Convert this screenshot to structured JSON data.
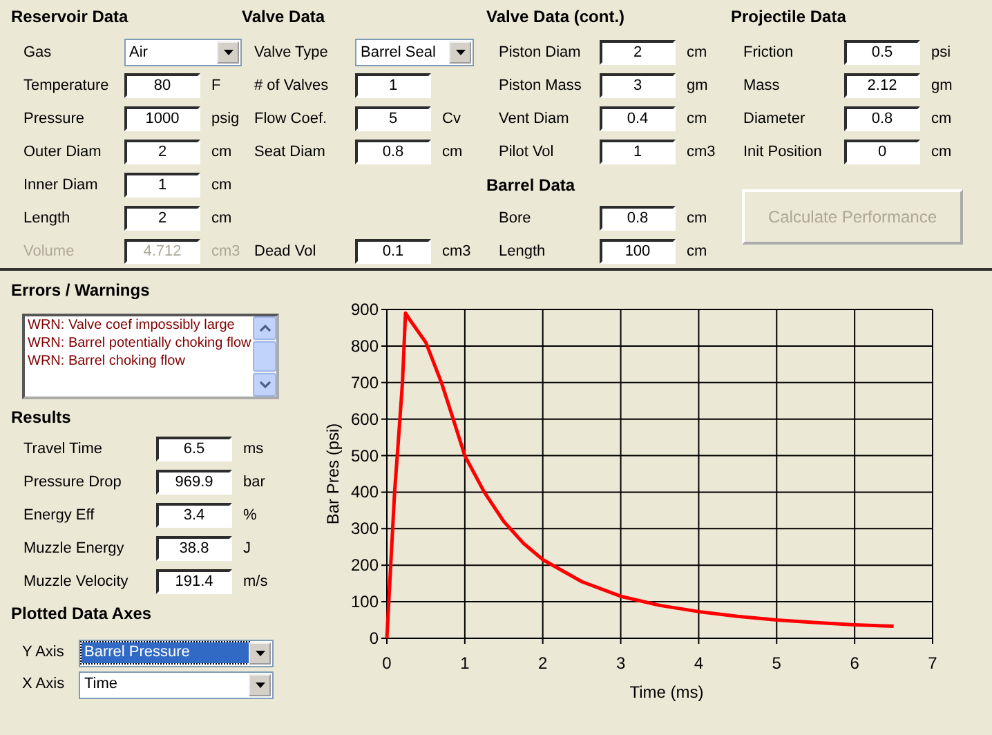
{
  "reservoir_data": {
    "title": "Reservoir Data",
    "fields": [
      {
        "kind": "dropdown",
        "label": "Gas",
        "value": "Air",
        "disabled": false
      },
      {
        "kind": "input",
        "label": "Temperature",
        "value": "80",
        "unit": "F",
        "disabled": false
      },
      {
        "kind": "input",
        "label": "Pressure",
        "value": "1000",
        "unit": "psig",
        "disabled": false
      },
      {
        "kind": "input",
        "label": "Outer Diam",
        "value": "2",
        "unit": "cm",
        "disabled": false
      },
      {
        "kind": "input",
        "label": "Inner Diam",
        "value": "1",
        "unit": "cm",
        "disabled": false
      },
      {
        "kind": "input",
        "label": "Length",
        "value": "2",
        "unit": "cm",
        "disabled": false
      },
      {
        "kind": "input",
        "label": "Volume",
        "value": "4.712",
        "unit": "cm3",
        "disabled": true
      }
    ]
  },
  "valve_data": {
    "title": "Valve Data",
    "fields": [
      {
        "kind": "dropdown",
        "label": "Valve Type",
        "value": "Barrel Seal"
      },
      {
        "kind": "input",
        "label": "# of Valves",
        "value": "1"
      },
      {
        "kind": "input",
        "label": "Flow Coef.",
        "value": "5",
        "unit": "Cv"
      },
      {
        "kind": "input",
        "label": "Seat Diam",
        "value": "0.8",
        "unit": "cm"
      },
      {
        "kind": "input",
        "label": "Dead Vol",
        "value": "0.1",
        "unit": "cm3"
      }
    ]
  },
  "valve_data_cont": {
    "title": "Valve Data (cont.)",
    "fields": [
      {
        "kind": "input",
        "label": "Piston Diam",
        "value": "2",
        "unit": "cm"
      },
      {
        "kind": "input",
        "label": "Piston Mass",
        "value": "3",
        "unit": "gm"
      },
      {
        "kind": "input",
        "label": "Vent Diam",
        "value": "0.4",
        "unit": "cm"
      },
      {
        "kind": "input",
        "label": "Pilot Vol",
        "value": "1",
        "unit": "cm3"
      }
    ]
  },
  "barrel_data": {
    "title": "Barrel Data",
    "fields": [
      {
        "kind": "input",
        "label": "Bore",
        "value": "0.8",
        "unit": "cm"
      },
      {
        "kind": "input",
        "label": "Length",
        "value": "100",
        "unit": "cm"
      }
    ]
  },
  "projectile_data": {
    "title": "Projectile Data",
    "fields": [
      {
        "kind": "input",
        "label": "Friction",
        "value": "0.5",
        "unit": "psi"
      },
      {
        "kind": "input",
        "label": "Mass",
        "value": "2.12",
        "unit": "gm"
      },
      {
        "kind": "input",
        "label": "Diameter",
        "value": "0.8",
        "unit": "cm"
      },
      {
        "kind": "input",
        "label": "Init Position",
        "value": "0",
        "unit": "cm"
      }
    ]
  },
  "calculate_button": {
    "label": "Calculate Performance",
    "disabled": true
  },
  "errors_warnings": {
    "title": "Errors / Warnings",
    "messages": [
      "WRN: Valve coef impossibly large",
      "WRN: Barrel potentially choking flow",
      "WRN: Barrel choking flow"
    ]
  },
  "results": {
    "title": "Results",
    "fields": [
      {
        "label": "Travel Time",
        "value": "6.5",
        "unit": "ms"
      },
      {
        "label": "Pressure Drop",
        "value": "969.9",
        "unit": "bar"
      },
      {
        "label": "Energy Eff",
        "value": "3.4",
        "unit": "%"
      },
      {
        "label": "Muzzle Energy",
        "value": "38.8",
        "unit": "J"
      },
      {
        "label": "Muzzle Velocity",
        "value": "191.4",
        "unit": "m/s"
      }
    ]
  },
  "plotted_data_axes": {
    "title": "Plotted Data Axes",
    "axes": [
      {
        "label": "Y Axis",
        "value": "Barrel Pressure",
        "highlighted": true
      },
      {
        "label": "X Axis",
        "value": "Time",
        "highlighted": false
      }
    ]
  },
  "chart": {
    "chart_data": {
      "type": "line",
      "xlabel": "Time (ms)",
      "ylabel": "Bar Pres (psi)",
      "x": [
        0,
        0.05,
        0.1,
        0.15,
        0.2,
        0.24,
        0.3,
        0.5,
        0.7,
        0.85,
        1,
        1.25,
        1.5,
        1.75,
        2,
        2.5,
        3,
        3.5,
        4,
        4.5,
        5,
        5.5,
        6,
        6.5
      ],
      "series": [
        {
          "color": "#ff0000",
          "values": [
            0,
            200,
            400,
            550,
            700,
            890,
            870,
            810,
            700,
            600,
            500,
            400,
            320,
            260,
            215,
            155,
            115,
            90,
            73,
            60,
            50,
            43,
            37,
            33
          ]
        }
      ],
      "grid": true,
      "xlim": [
        0,
        7
      ],
      "ylim": [
        0,
        900
      ],
      "xticks": [
        0,
        1,
        2,
        3,
        4,
        5,
        6,
        7
      ],
      "yticks": [
        0,
        100,
        200,
        300,
        400,
        500,
        600,
        700,
        800,
        900
      ]
    }
  }
}
